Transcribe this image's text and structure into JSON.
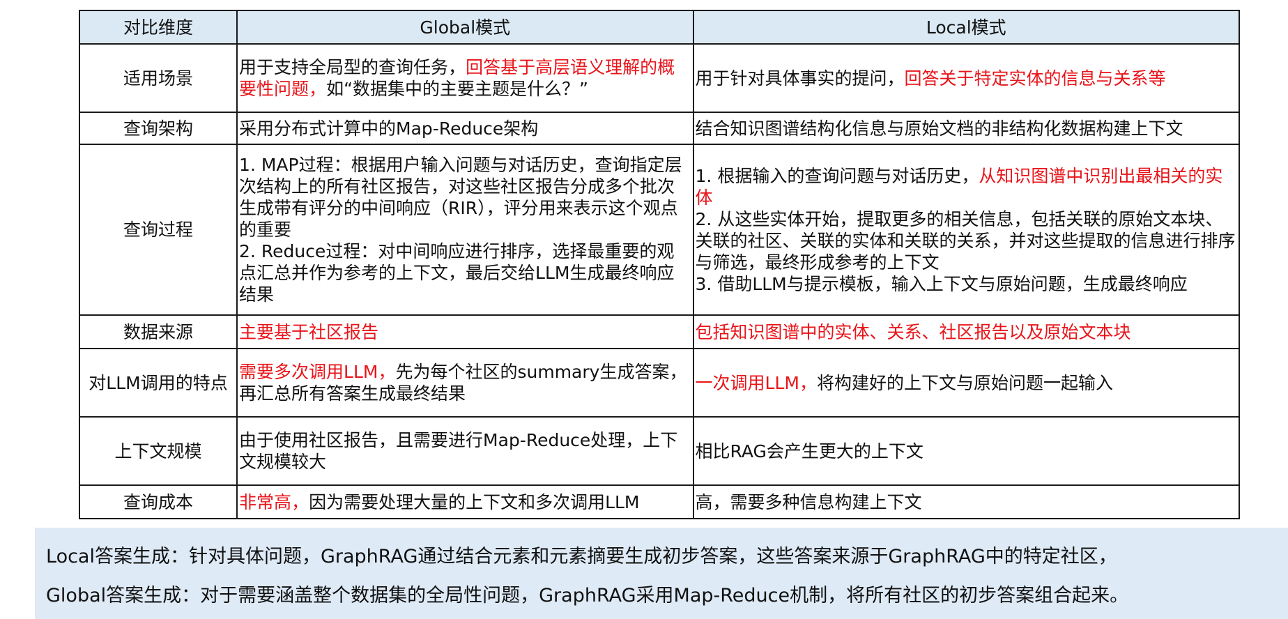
{
  "table": {
    "headers": [
      "对比维度",
      "Global模式",
      "Local模式"
    ],
    "rows": [
      {
        "dimension": "适用场景",
        "global": [
          "用于支持全局型的查询任务，",
          "回答基于高层语义理解的概要性问题，",
          "如“数据集中的主要主题是什么？”"
        ],
        "local": [
          "用于针对具体事实的提问，",
          "回答关于特定实体的信息与关系等"
        ]
      },
      {
        "dimension": "查询架构",
        "global": [
          "采用分布式计算中的Map-Reduce架构"
        ],
        "local": [
          "结合知识图谱结构化信息与原始文档的非结构化数据构建上下文"
        ]
      },
      {
        "dimension": "查询过程",
        "global": [
          "1. MAP过程：根据用户输入问题与对话历史，查询指定层次结构上的所有社区报告，对这些社区报告分成多个批次生成带有评分的中间响应（RIR），评分用来表示这个观点的重要",
          "2. Reduce过程：对中间响应进行排序，选择最重要的观点汇总并作为参考的上下文，最后交给LLM生成最终响应结果"
        ],
        "local": [
          "1. 根据输入的查询问题与对话历史，",
          "从知识图谱中识别出最相关的实体",
          "2. 从这些实体开始，提取更多的相关信息，包括关联的原始文本块、关联的社区、关联的实体和关联的关系，并对这些提取的信息进行排序与筛选，最终形成参考的上下文",
          "3. 借助LLM与提示模板，输入上下文与原始问题，生成最终响应"
        ]
      },
      {
        "dimension": "数据来源",
        "global": [
          "主要基于社区报告"
        ],
        "local": [
          "包括知识图谱中的实体、关系、社区报告以及原始文本块"
        ]
      },
      {
        "dimension": "对LLM调用的特点",
        "global": [
          "需要多次调用LLM，",
          "先为每个社区的summary生成答案，再汇总所有答案生成最终结果"
        ],
        "local": [
          "一次调用LLM，",
          "将构建好的上下文与原始问题一起输入"
        ]
      },
      {
        "dimension": "上下文规模",
        "global": [
          "由于使用社区报告，且需要进行Map-Reduce处理，上下文规模较大"
        ],
        "local": [
          "相比RAG会产生更大的上下文"
        ]
      },
      {
        "dimension": "查询成本",
        "global": [
          "非常高，",
          "因为需要处理大量的上下文和多次调用LLM"
        ],
        "local": [
          "高，需要多种信息构建上下文"
        ]
      }
    ]
  },
  "summary": {
    "local_line": "Local答案生成：针对具体问题，GraphRAG通过结合元素和元素摘要生成初步答案，这些答案来源于GraphRAG中的特定社区，",
    "global_line": "Global答案生成：对于需要涵盖整个数据集的全局性问题，GraphRAG采用Map-Reduce机制，将所有社区的初步答案组合起来。"
  },
  "colors": {
    "header_bg": "#dbe9f5",
    "highlight_red": "#e8141a",
    "summary_bg": "#deeaf6",
    "border": "#1a1a1a"
  }
}
